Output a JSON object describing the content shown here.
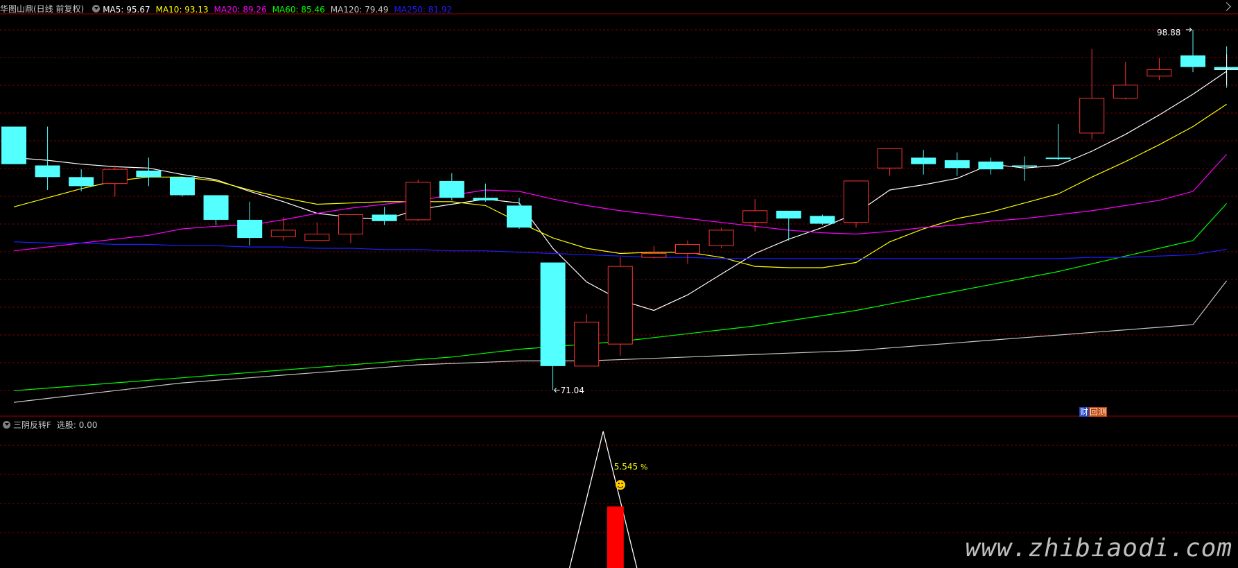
{
  "main_panel": {
    "title": "华图山鼎(日线 前复权)",
    "ma_legend": [
      {
        "label": "MA5: 95.67",
        "color": "#ffffff"
      },
      {
        "label": "MA10: 93.13",
        "color": "#ffff00"
      },
      {
        "label": "MA20: 89.26",
        "color": "#ff00ff"
      },
      {
        "label": "MA60: 85.46",
        "color": "#00ff00"
      },
      {
        "label": "MA120: 79.49",
        "color": "#c8c8c8"
      },
      {
        "label": "MA250: 81.92",
        "color": "#1e1eff"
      }
    ],
    "high_label": "98.88",
    "low_label": "71.04",
    "badge": {
      "left": "财",
      "right": "回测"
    }
  },
  "sub_panel": {
    "title": "三阴反转F",
    "value_label": "选股: 0.00",
    "percent_label": "5.545",
    "percent_sign": "%",
    "smile": "☻"
  },
  "watermark": "www.zhibiaodi.com",
  "colors": {
    "up": "#ff3232",
    "down": "#54ffff",
    "grid": "#7a0000",
    "border": "#a00000",
    "ma5": "#ffffff",
    "ma10": "#ffff00",
    "ma20": "#ff00ff",
    "ma60": "#00ff00",
    "ma120": "#c8c8c8",
    "ma250": "#1e1eff",
    "signal_bar": "#ff0000",
    "annotation": "#ffff00"
  },
  "chart_data": [
    {
      "type": "candlestick",
      "ylim": [
        70,
        100
      ],
      "candles": [
        {
          "o": 91.4,
          "h": 91.4,
          "c": 88.5,
          "l": 88.5
        },
        {
          "o": 88.4,
          "h": 91.4,
          "c": 87.5,
          "l": 86.5
        },
        {
          "o": 87.5,
          "h": 88.1,
          "c": 86.8,
          "l": 86.4
        },
        {
          "o": 87.0,
          "h": 88.4,
          "c": 88.1,
          "l": 86.0
        },
        {
          "o": 88.0,
          "h": 89.0,
          "c": 87.5,
          "l": 86.8
        },
        {
          "o": 87.5,
          "h": 87.5,
          "c": 86.1,
          "l": 86.0
        },
        {
          "o": 86.1,
          "h": 86.1,
          "c": 84.2,
          "l": 83.8
        },
        {
          "o": 84.2,
          "h": 85.6,
          "c": 82.8,
          "l": 82.2
        },
        {
          "o": 82.9,
          "h": 84.4,
          "c": 83.4,
          "l": 82.6
        },
        {
          "o": 82.6,
          "h": 84.0,
          "c": 83.1,
          "l": 82.6
        },
        {
          "o": 83.1,
          "h": 84.6,
          "c": 84.6,
          "l": 82.4
        },
        {
          "o": 84.6,
          "h": 85.2,
          "c": 84.1,
          "l": 83.8
        },
        {
          "o": 84.2,
          "h": 87.3,
          "c": 87.1,
          "l": 84.1
        },
        {
          "o": 87.2,
          "h": 87.8,
          "c": 85.9,
          "l": 85.7
        },
        {
          "o": 85.9,
          "h": 87.0,
          "c": 85.7,
          "l": 85.6
        },
        {
          "o": 85.3,
          "h": 85.9,
          "c": 83.6,
          "l": 83.5
        },
        {
          "o": 80.9,
          "h": 80.9,
          "c": 72.9,
          "l": 71.04
        },
        {
          "o": 72.9,
          "h": 76.9,
          "c": 76.3,
          "l": 72.9
        },
        {
          "o": 74.6,
          "h": 81.3,
          "c": 80.6,
          "l": 73.7
        },
        {
          "o": 81.3,
          "h": 82.2,
          "c": 81.6,
          "l": 81.2
        },
        {
          "o": 81.6,
          "h": 82.6,
          "c": 82.3,
          "l": 80.8
        },
        {
          "o": 82.2,
          "h": 83.6,
          "c": 83.4,
          "l": 82.0
        },
        {
          "o": 84.0,
          "h": 85.8,
          "c": 84.9,
          "l": 83.3
        },
        {
          "o": 84.9,
          "h": 84.9,
          "c": 84.3,
          "l": 82.6
        },
        {
          "o": 84.5,
          "h": 84.6,
          "c": 83.9,
          "l": 83.8
        },
        {
          "o": 84.0,
          "h": 87.2,
          "c": 87.2,
          "l": 83.6
        },
        {
          "o": 88.2,
          "h": 89.3,
          "c": 89.7,
          "l": 87.6
        },
        {
          "o": 89.0,
          "h": 89.6,
          "c": 88.5,
          "l": 87.7
        },
        {
          "o": 88.8,
          "h": 89.4,
          "c": 88.2,
          "l": 87.6
        },
        {
          "o": 88.7,
          "h": 89.0,
          "c": 88.1,
          "l": 87.7
        },
        {
          "o": 88.4,
          "h": 89.1,
          "c": 88.3,
          "l": 87.2
        },
        {
          "o": 89.0,
          "h": 91.6,
          "c": 88.9,
          "l": 88.8
        },
        {
          "o": 90.9,
          "h": 97.4,
          "c": 93.6,
          "l": 90.4
        },
        {
          "o": 93.6,
          "h": 96.4,
          "c": 94.6,
          "l": 93.5
        },
        {
          "o": 95.3,
          "h": 96.7,
          "c": 95.8,
          "l": 95.0
        },
        {
          "o": 96.9,
          "h": 98.88,
          "c": 96.0,
          "l": 95.6
        },
        {
          "o": 96.0,
          "h": 97.6,
          "c": 95.8,
          "l": 94.4
        }
      ],
      "ma": {
        "MA5": [
          89.0,
          88.8,
          88.5,
          88.3,
          88.2,
          87.7,
          87.3,
          86.4,
          85.6,
          84.7,
          84.4,
          84.2,
          85.0,
          85.4,
          85.8,
          85.5,
          82.0,
          79.4,
          78.0,
          77.2,
          78.4,
          80.0,
          81.6,
          82.7,
          83.6,
          84.7,
          86.5,
          86.9,
          87.4,
          88.5,
          88.2,
          88.4,
          89.5,
          90.8,
          92.3,
          93.9,
          95.67
        ],
        "MA10": [
          85.2,
          85.9,
          86.6,
          87.2,
          87.5,
          87.5,
          87.2,
          86.5,
          85.9,
          85.4,
          85.5,
          85.6,
          85.6,
          85.6,
          85.3,
          84.0,
          82.8,
          82.0,
          81.6,
          81.7,
          81.7,
          81.3,
          80.6,
          80.5,
          80.5,
          80.9,
          82.5,
          83.5,
          84.3,
          84.8,
          85.5,
          86.2,
          87.5,
          88.7,
          90.0,
          91.4,
          93.13
        ],
        "MA20": [
          81.8,
          82.1,
          82.4,
          82.7,
          83.0,
          83.5,
          83.7,
          83.8,
          84.2,
          84.7,
          85.1,
          85.4,
          85.7,
          86.1,
          86.5,
          86.4,
          85.8,
          85.3,
          84.9,
          84.6,
          84.3,
          84.0,
          83.7,
          83.4,
          83.2,
          83.1,
          83.3,
          83.6,
          83.8,
          84.1,
          84.3,
          84.6,
          84.9,
          85.3,
          85.7,
          86.4,
          89.26
        ],
        "MA60": [
          71.0,
          71.2,
          71.4,
          71.6,
          71.8,
          72.0,
          72.2,
          72.4,
          72.6,
          72.8,
          73.0,
          73.2,
          73.4,
          73.6,
          73.9,
          74.2,
          74.4,
          74.6,
          74.8,
          75.1,
          75.4,
          75.7,
          76.0,
          76.4,
          76.8,
          77.2,
          77.7,
          78.2,
          78.7,
          79.2,
          79.7,
          80.2,
          80.8,
          81.4,
          82.0,
          82.6,
          85.46
        ],
        "MA120": [
          70.1,
          70.4,
          70.7,
          71.0,
          71.3,
          71.6,
          71.8,
          72.0,
          72.2,
          72.4,
          72.6,
          72.8,
          73.0,
          73.1,
          73.2,
          73.3,
          73.3,
          73.3,
          73.4,
          73.5,
          73.6,
          73.7,
          73.8,
          73.9,
          74.0,
          74.1,
          74.3,
          74.5,
          74.7,
          74.9,
          75.1,
          75.3,
          75.5,
          75.7,
          75.9,
          76.1,
          79.49
        ],
        "MA250": [
          82.5,
          82.4,
          82.4,
          82.3,
          82.3,
          82.2,
          82.2,
          82.1,
          82.1,
          82.0,
          82.0,
          81.9,
          81.9,
          81.8,
          81.8,
          81.7,
          81.6,
          81.5,
          81.4,
          81.3,
          81.3,
          81.2,
          81.2,
          81.2,
          81.2,
          81.2,
          81.2,
          81.2,
          81.2,
          81.2,
          81.2,
          81.2,
          81.3,
          81.3,
          81.4,
          81.5,
          81.92
        ]
      }
    },
    {
      "type": "signal",
      "signal_index": 18,
      "line_points": [
        [
          16,
          0
        ],
        [
          17,
          1
        ],
        [
          18,
          0
        ]
      ],
      "bar_value": 0.45
    }
  ]
}
